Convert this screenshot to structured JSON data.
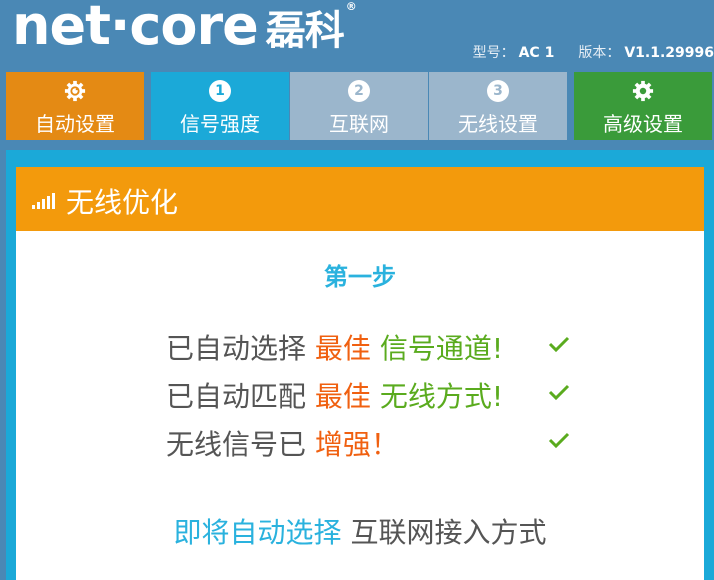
{
  "brand": {
    "logo_text": "net·core",
    "logo_cn": "磊科",
    "registered": "®"
  },
  "model_info": {
    "model_label": "型号：",
    "model_value": "AC 1",
    "version_label": "版本：",
    "version_value": "V1.1.29996"
  },
  "nav": {
    "auto_setup": "自动设置",
    "step1": {
      "num": "1",
      "label": "信号强度"
    },
    "step2": {
      "num": "2",
      "label": "互联网"
    },
    "step3": {
      "num": "3",
      "label": "无线设置"
    },
    "advanced": "高级设置"
  },
  "panel": {
    "title": "无线优化",
    "step_title": "第一步",
    "rows": [
      {
        "prefix": "已自动选择",
        "best": "最佳",
        "suffix": "信号通道!"
      },
      {
        "prefix": "已自动匹配",
        "best": "最佳",
        "suffix": "无线方式!"
      },
      {
        "prefix": "无线信号已",
        "best": "增强！"
      }
    ],
    "bottom_highlight": "即将自动选择",
    "bottom_rest": "互联网接入方式"
  },
  "colors": {
    "orange": "#f39a0c",
    "blue": "#1ba9d8",
    "green": "#3a9b3a",
    "red_orange": "#f06010"
  }
}
